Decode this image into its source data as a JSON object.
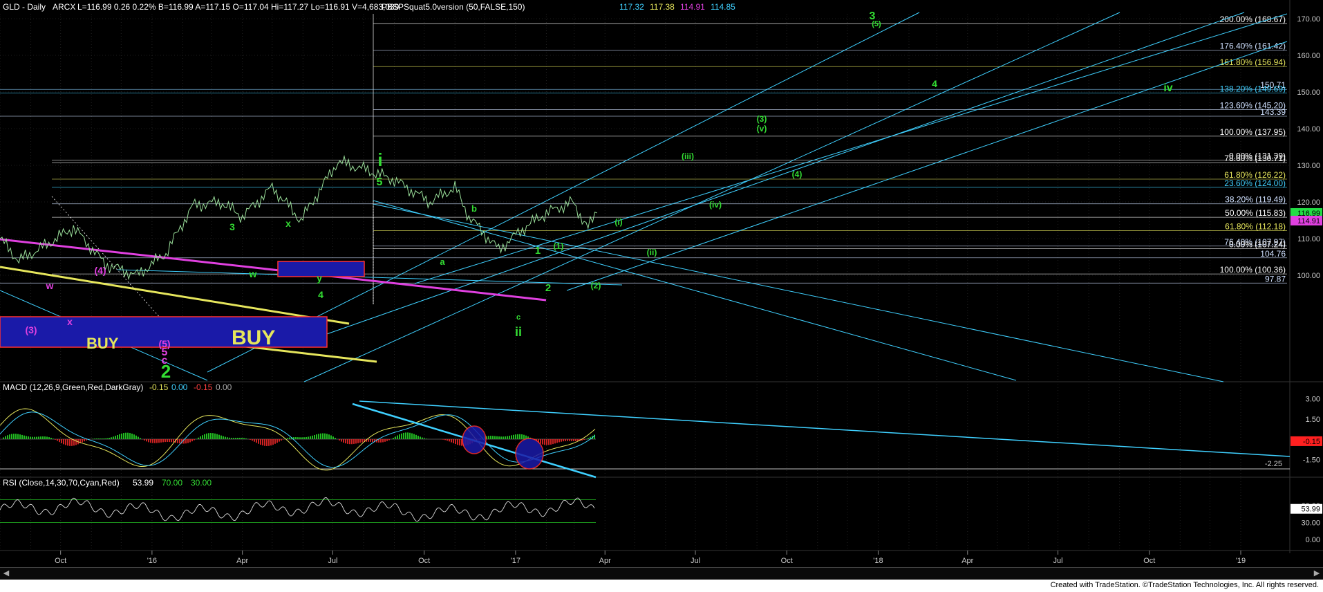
{
  "header": {
    "symbol": "GLD - Daily",
    "exchange": "ARCX",
    "quote": "L=116.99  0.26  0.22%  B=116.99  A=117.15  O=117.04  Hi=117.27  Lo=116.91  V=4,683,039",
    "indicator": "PBSPSquat5.0version (50,FALSE,150)",
    "values": [
      {
        "text": "117.32",
        "color": "#3fd0ff"
      },
      {
        "text": "117.38",
        "color": "#e6e65c"
      },
      {
        "text": "114.91",
        "color": "#e040e0"
      },
      {
        "text": "114.85",
        "color": "#3fd0ff"
      }
    ]
  },
  "price_axis": [
    "170.00",
    "160.00",
    "150.00",
    "140.00",
    "130.00",
    "120.00",
    "110.00",
    "100.00"
  ],
  "last_price_badges": [
    {
      "text": "116.99",
      "bg": "#22dd44"
    },
    {
      "text": "114.91",
      "bg": "#e040e0"
    }
  ],
  "fib_labels": [
    {
      "text": "200.00% (168.67)",
      "color": "#ffffff"
    },
    {
      "text": "176.40% (161.42)",
      "color": "#cfe0ff"
    },
    {
      "text": "161.80% (156.94)",
      "color": "#e6e65c"
    },
    {
      "text": "150.71",
      "color": "#cfe0ff"
    },
    {
      "text": "138.20% (149.69)",
      "color": "#3fd0ff"
    },
    {
      "text": "123.60% (145.20)",
      "color": "#cfe0ff"
    },
    {
      "text": "143.39",
      "color": "#cfe0ff"
    },
    {
      "text": "100.00% (137.95)",
      "color": "#ffffff"
    },
    {
      "text": "0.00% (131.39)",
      "color": "#ffffff"
    },
    {
      "text": "78.60% (130.71)",
      "color": "#ffffff"
    },
    {
      "text": "61.80% (126.22)",
      "color": "#e6e65c"
    },
    {
      "text": "23.60% (124.00)",
      "color": "#3fd0ff"
    },
    {
      "text": "38.20% (119.49)",
      "color": "#cfe0ff"
    },
    {
      "text": "50.00% (115.83)",
      "color": "#ffffff"
    },
    {
      "text": "61.80% (112.18)",
      "color": "#e6e65c"
    },
    {
      "text": "76.40% (107.97)",
      "color": "#cfe0ff"
    },
    {
      "text": "0.00% (107.24)",
      "color": "#ffffff"
    },
    {
      "text": "104.76",
      "color": "#cfe0ff"
    },
    {
      "text": "100.00% (100.36)",
      "color": "#ffffff"
    },
    {
      "text": "97.87",
      "color": "#cfe0ff"
    }
  ],
  "wave_labels": [
    {
      "text": "3",
      "color": "#33dd33"
    },
    {
      "text": "(5)",
      "color": "#33dd33"
    },
    {
      "text": "4",
      "color": "#33dd33"
    },
    {
      "text": "iv",
      "color": "#33dd33"
    },
    {
      "text": "(3)",
      "color": "#33dd33"
    },
    {
      "text": "(v)",
      "color": "#33dd33"
    },
    {
      "text": "(iii)",
      "color": "#33dd33"
    },
    {
      "text": "(4)",
      "color": "#33dd33"
    },
    {
      "text": "(iv)",
      "color": "#33dd33"
    },
    {
      "text": "(i)",
      "color": "#33dd33"
    },
    {
      "text": "(ii)",
      "color": "#33dd33"
    },
    {
      "text": "i",
      "color": "#33dd33"
    },
    {
      "text": "5",
      "color": "#33dd33"
    },
    {
      "text": "b",
      "color": "#33dd33"
    },
    {
      "text": "a",
      "color": "#33dd33"
    },
    {
      "text": "c",
      "color": "#33dd33"
    },
    {
      "text": "ii",
      "color": "#33dd33"
    },
    {
      "text": "1",
      "color": "#33dd33"
    },
    {
      "text": "(1)",
      "color": "#33dd33"
    },
    {
      "text": "2",
      "color": "#33dd33"
    },
    {
      "text": "(2)",
      "color": "#33dd33"
    },
    {
      "text": "3",
      "color": "#33dd33"
    },
    {
      "text": "x",
      "color": "#33dd33"
    },
    {
      "text": "w",
      "color": "#33dd33"
    },
    {
      "text": "y",
      "color": "#33dd33"
    },
    {
      "text": "4",
      "color": "#33dd33"
    },
    {
      "text": "w",
      "color": "#e040e0"
    },
    {
      "text": "(4)",
      "color": "#e040e0"
    },
    {
      "text": "x",
      "color": "#e040e0"
    },
    {
      "text": "(3)",
      "color": "#e040e0"
    },
    {
      "text": "(5)",
      "color": "#e040e0"
    },
    {
      "text": "5",
      "color": "#e040e0"
    },
    {
      "text": "c",
      "color": "#e040e0"
    },
    {
      "text": "2",
      "color": "#33dd33"
    }
  ],
  "buy_labels": [
    "BUY",
    "BUY"
  ],
  "macd": {
    "title": "MACD (12,26,9,Green,Red,DarkGray)",
    "values": [
      {
        "text": "-0.15",
        "color": "#e6e65c"
      },
      {
        "text": "0.00",
        "color": "#3fd0ff"
      },
      {
        "text": "-0.15",
        "color": "#ff4040"
      },
      {
        "text": "0.00",
        "color": "#aaaaaa"
      }
    ],
    "axis": [
      "3.00",
      "1.50",
      "0.00",
      "-1.50"
    ],
    "badge": "-0.15",
    "line_label": "-2.25"
  },
  "rsi": {
    "title": "RSI (Close,14,30,70,Cyan,Red)",
    "values": [
      {
        "text": "53.99",
        "color": "#ffffff"
      },
      {
        "text": "70.00",
        "color": "#33dd33"
      },
      {
        "text": "30.00",
        "color": "#33dd33"
      }
    ],
    "axis": [
      "60.00",
      "30.00",
      "0.00"
    ],
    "badge": "53.99"
  },
  "time_axis": [
    "Oct",
    "'16",
    "Apr",
    "Jul",
    "Oct",
    "'17",
    "Apr",
    "Jul",
    "Oct",
    "'18",
    "Apr",
    "Jul",
    "Oct",
    "'19"
  ],
  "footer": "Created with TradeStation. ©TradeStation Technologies, Inc. All rights reserved.",
  "chart_data": {
    "type": "line",
    "title": "GLD - Daily",
    "x_range": [
      "2015-08",
      "2019-01"
    ],
    "ylim": [
      92,
      172
    ],
    "price_series_approx": [
      {
        "x": "2015-08-01",
        "y": 110
      },
      {
        "x": "2015-08-20",
        "y": 104
      },
      {
        "x": "2015-09-15",
        "y": 108
      },
      {
        "x": "2015-10-14",
        "y": 113
      },
      {
        "x": "2015-11-15",
        "y": 103
      },
      {
        "x": "2015-12-17",
        "y": 100
      },
      {
        "x": "2016-01-15",
        "y": 106
      },
      {
        "x": "2016-02-11",
        "y": 119
      },
      {
        "x": "2016-03-10",
        "y": 120
      },
      {
        "x": "2016-04-01",
        "y": 116
      },
      {
        "x": "2016-05-01",
        "y": 124
      },
      {
        "x": "2016-05-30",
        "y": 115
      },
      {
        "x": "2016-07-06",
        "y": 131
      },
      {
        "x": "2016-08-01",
        "y": 129
      },
      {
        "x": "2016-09-01",
        "y": 126
      },
      {
        "x": "2016-10-07",
        "y": 120
      },
      {
        "x": "2016-11-01",
        "y": 124
      },
      {
        "x": "2016-11-15",
        "y": 116
      },
      {
        "x": "2016-12-15",
        "y": 107
      },
      {
        "x": "2017-01-10",
        "y": 113
      },
      {
        "x": "2017-02-01",
        "y": 117
      },
      {
        "x": "2017-02-27",
        "y": 120
      },
      {
        "x": "2017-03-15",
        "y": 113
      },
      {
        "x": "2017-03-24",
        "y": 117
      }
    ],
    "macd_range": [
      -2.25,
      3.5
    ],
    "rsi_range": [
      0,
      100
    ]
  }
}
